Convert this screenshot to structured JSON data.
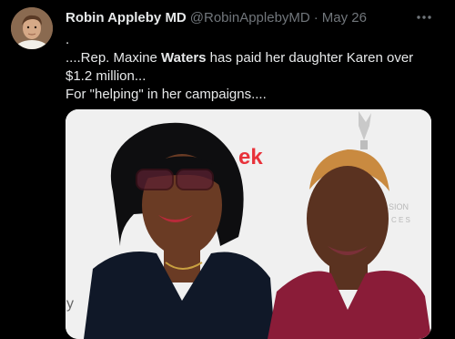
{
  "author": {
    "display_name": "Robin Appleby MD",
    "handle": "@RobinApplebyMD",
    "separator": "·",
    "date": "May 26"
  },
  "tweet": {
    "line0": ".",
    "line1_pre": "....Rep. Maxine ",
    "line1_bold": "Waters",
    "line1_post": " has paid her daughter Karen over",
    "line2": "$1.2 million...",
    "line3": "For \"helping\" in her campaigns...."
  },
  "photo": {
    "backdrop_text": "ek",
    "backdrop_text_2": "SION",
    "backdrop_text_3": "C E S",
    "edge_letter": "y"
  },
  "colors": {
    "background": "#000000",
    "text": "#e7e9ea",
    "muted": "#71767b",
    "backdrop_logo": "#e8323a"
  },
  "icons": [
    "avatar",
    "more-icon",
    "award-statuette-icon"
  ]
}
